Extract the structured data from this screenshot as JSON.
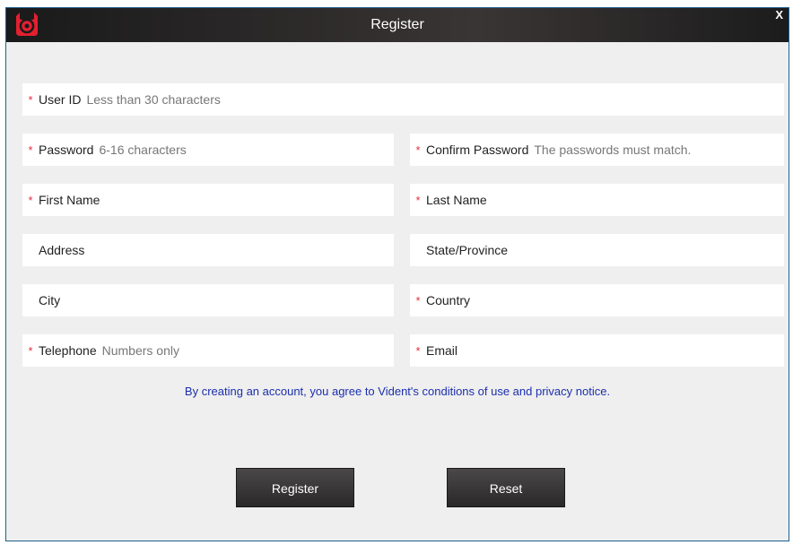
{
  "window": {
    "title": "Register",
    "close_label": "X"
  },
  "form": {
    "user_id": {
      "label": "User ID",
      "hint": "Less than 30 characters",
      "required": true
    },
    "password": {
      "label": "Password",
      "hint": "6-16 characters",
      "required": true
    },
    "confirm_password": {
      "label": "Confirm Password",
      "hint": "The passwords must match.",
      "required": true
    },
    "first_name": {
      "label": "First Name",
      "required": true
    },
    "last_name": {
      "label": "Last Name",
      "required": true
    },
    "address": {
      "label": "Address",
      "required": false
    },
    "state_province": {
      "label": "State/Province",
      "required": false
    },
    "city": {
      "label": "City",
      "required": false
    },
    "country": {
      "label": "Country",
      "required": true
    },
    "telephone": {
      "label": "Telephone",
      "hint": "Numbers only",
      "required": true
    },
    "email": {
      "label": "Email",
      "required": true
    },
    "required_marker": "*"
  },
  "terms": "By creating an account, you agree to Vident's conditions of use and privacy notice.",
  "buttons": {
    "register": "Register",
    "reset": "Reset"
  },
  "colors": {
    "required": "#e0303c",
    "terms_link": "#1b2fae",
    "window_border": "#1f5f8f"
  },
  "icons": {
    "logo": "app-logo-icon",
    "close": "close-icon"
  }
}
